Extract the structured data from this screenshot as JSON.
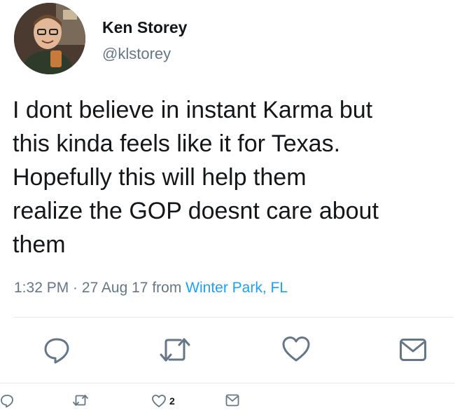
{
  "user": {
    "display_name": "Ken Storey",
    "handle": "@klstorey"
  },
  "tweet": {
    "text": "I dont believe in instant Karma but\nthis kinda feels like it for Texas.\nHopefully this will help them\nrealize the GOP doesnt care about\nthem",
    "time": "1:32 PM",
    "separator": " · ",
    "date": "27 Aug 17",
    "from_label": " from ",
    "location": "Winter Park, FL"
  },
  "actions": [
    {
      "icon": "reply-icon"
    },
    {
      "icon": "retweet-icon"
    },
    {
      "icon": "like-icon"
    },
    {
      "icon": "message-icon"
    }
  ],
  "secondary_actions": {
    "like_count": "2"
  },
  "colors": {
    "text": "#14171a",
    "secondary": "#657786",
    "link": "#1da1f2",
    "divider": "#e1e8ed"
  }
}
